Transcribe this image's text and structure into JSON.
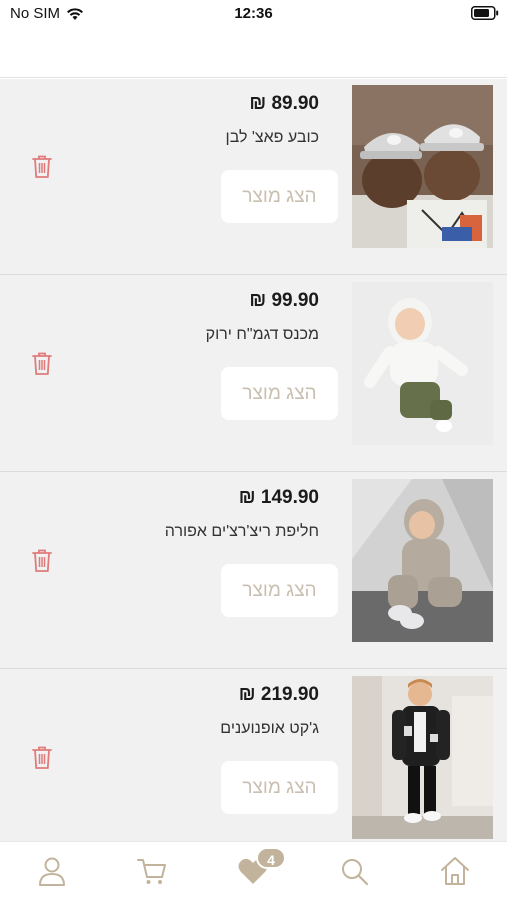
{
  "status_bar": {
    "carrier": "No SIM",
    "time": "12:36"
  },
  "products": [
    {
      "price": "89.90 ₪",
      "name": "כובע פאצ' לבן",
      "view_label": "הצג מוצר",
      "image": "two-kids-white-caps-photo"
    },
    {
      "price": "99.90 ₪",
      "name": "מכנס דגמ\"ח ירוק",
      "view_label": "הצג מוצר",
      "image": "baby-white-hoodie-green-pants-photo"
    },
    {
      "price": "149.90 ₪",
      "name": "חליפת ריצ'רצ'ים אפורה",
      "view_label": "הצג מוצר",
      "image": "child-grey-tracksuit-photo"
    },
    {
      "price": "219.90 ₪",
      "name": "ג'קט אופנוענים",
      "view_label": "הצג מוצר",
      "image": "boy-black-bomber-jacket-photo"
    }
  ],
  "tabbar": {
    "wishlist_count": "4",
    "tabs": [
      "user-icon",
      "cart-icon",
      "heart-icon",
      "search-icon",
      "home-icon"
    ]
  },
  "colors": {
    "accent": "#c2b49c",
    "trash": "#e07b7b",
    "list_bg": "#f1f1f1",
    "button_text": "#c9bfb1"
  }
}
